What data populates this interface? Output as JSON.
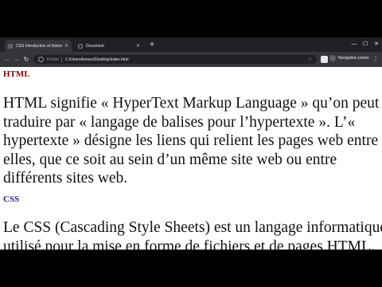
{
  "browser": {
    "tabs": [
      {
        "label": "CSS Introduction et historique -",
        "active": true
      },
      {
        "label": "Document",
        "active": false
      }
    ],
    "new_tab_label": "+",
    "address": {
      "scheme": "Fichier",
      "url": "C:/Users/lenovo/Desktop/index.html"
    },
    "incognito_label": "Navigation privée"
  },
  "page": {
    "section1": {
      "heading": "HTML",
      "heading_color": "#8b0000",
      "lines": [
        "HTML signifie « HyperText Markup Language » qu’on peut",
        "traduire par « langage de balises pour l’hypertexte ». L’«",
        "hypertexte » désigne les liens qui relient les pages web entre",
        "elles, que ce soit au sein d’un même site web ou entre",
        "différents sites web."
      ]
    },
    "section2": {
      "heading": "CSS",
      "heading_color": "#1a1a8c",
      "lines": [
        "Le CSS (Cascading Style Sheets) est un langage informatique",
        "utilisé pour la mise en forme de fichiers et de pages HTML."
      ]
    }
  },
  "icons": {
    "back": "arrow-left-icon",
    "forward": "arrow-right-icon",
    "reload": "reload-icon",
    "info": "info-icon",
    "star": "star-icon",
    "menu": "more-vert-icon"
  }
}
